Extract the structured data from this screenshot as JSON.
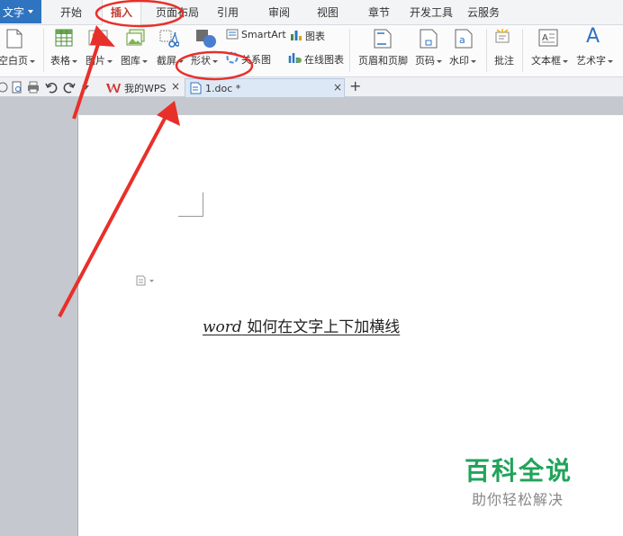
{
  "app_button": {
    "label": "文字"
  },
  "menu_tabs": [
    {
      "label": "开始"
    },
    {
      "label": "插入"
    },
    {
      "label": "页面布局"
    },
    {
      "label": "引用"
    },
    {
      "label": "审阅"
    },
    {
      "label": "视图"
    },
    {
      "label": "章节"
    },
    {
      "label": "开发工具"
    },
    {
      "label": "云服务"
    }
  ],
  "ribbon": {
    "blank_page": "空白页",
    "table": "表格",
    "picture": "图片",
    "gallery": "图库",
    "screenshot": "截屏",
    "shapes": "形状",
    "smartart": "SmartArt",
    "chart": "图表",
    "relation": "关系图",
    "online_chart": "在线图表",
    "header_footer": "页眉和页脚",
    "page_number": "页码",
    "watermark": "水印",
    "comment": "批注",
    "textbox": "文本框",
    "wordart": "艺术字",
    "wordart_glyph": "A"
  },
  "doc_tabs": [
    {
      "label": "我的WPS"
    },
    {
      "label": "1.doc *"
    }
  ],
  "new_tab": "+",
  "document": {
    "text_word": "word",
    "text_rest": " 如何在文字上下加横线"
  },
  "watermark": {
    "title": "百科全说",
    "subtitle": "助你轻松解决"
  },
  "colors": {
    "accent_blue": "#2f74c0",
    "active_tab_red": "#c0392b",
    "annotation_red": "#e8302a",
    "watermark_green": "#21a35a"
  }
}
